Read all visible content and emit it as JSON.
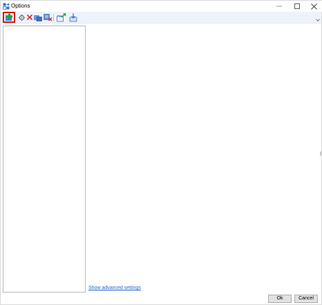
{
  "window": {
    "title": "Options",
    "icon": "options-app-icon",
    "controls": {
      "minimize": "—",
      "maximize": "☐",
      "close": "✕"
    }
  },
  "toolbar": {
    "buttons": [
      {
        "name": "add-icon",
        "color": "#2e9e3a"
      },
      {
        "name": "edit-icon",
        "color": "#7a7a7a"
      },
      {
        "name": "delete-icon",
        "color": "#d32f2f"
      },
      {
        "name": "copy-icon",
        "color": "#3b6fc4"
      },
      {
        "name": "remove-icon",
        "color": "#3b6fc4"
      },
      {
        "name": "export-icon",
        "color": "#3b6fc4"
      },
      {
        "name": "import-icon",
        "color": "#3b6fc4"
      }
    ],
    "overflow_icon": "chevron-down-icon",
    "highlight_color": "#e01010"
  },
  "links": {
    "advanced": "Show advanced settings"
  },
  "buttons": {
    "ok": "Ok",
    "cancel": "Cancel"
  }
}
